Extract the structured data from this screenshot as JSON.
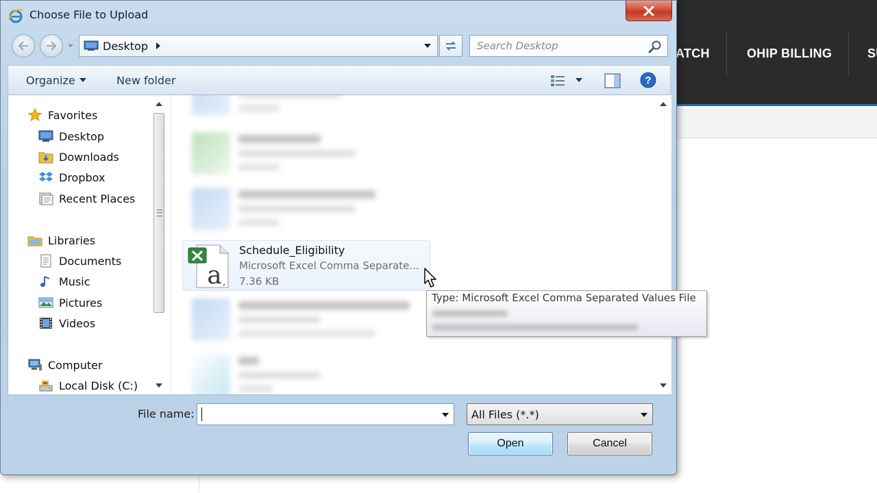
{
  "background_page": {
    "nav_items": [
      "ATCH",
      "OHIP BILLING",
      "SU"
    ]
  },
  "dialog": {
    "title": "Choose File to Upload",
    "address": {
      "location": "Desktop"
    },
    "search": {
      "placeholder": "Search Desktop"
    },
    "toolbar": {
      "organize_label": "Organize",
      "new_folder_label": "New folder"
    },
    "nav_pane": {
      "favorites": {
        "label": "Favorites",
        "items": [
          "Desktop",
          "Downloads",
          "Dropbox",
          "Recent Places"
        ]
      },
      "libraries": {
        "label": "Libraries",
        "items": [
          "Documents",
          "Music",
          "Pictures",
          "Videos"
        ]
      },
      "computer": {
        "label": "Computer",
        "items": [
          "Local Disk (C:)"
        ]
      }
    },
    "selected_file": {
      "name": "Schedule_Eligibility",
      "type": "Microsoft Excel Comma Separate...",
      "size": "7.36 KB"
    },
    "tooltip": {
      "line1": "Type: Microsoft Excel Comma Separated Values File"
    },
    "file_name": {
      "label": "File name:",
      "value": ""
    },
    "file_type": {
      "selected": "All Files (*.*)"
    },
    "buttons": {
      "open": "Open",
      "cancel": "Cancel"
    }
  },
  "colors": {
    "header_dark": "#2b2b2b",
    "header_accent": "#1f6fb6",
    "dialog_frame": "#bcd2e8",
    "close_red": "#c23a22",
    "open_button_blue": "#bee6fd"
  }
}
